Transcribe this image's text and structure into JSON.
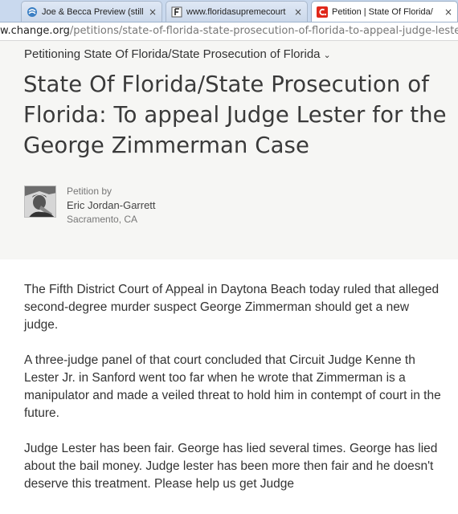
{
  "tabs": [
    {
      "title": "Joe & Becca Preview (still",
      "icon": "globe-icon",
      "active": false
    },
    {
      "title": "www.floridasupremecourt",
      "icon": "f-site-icon",
      "active": false
    },
    {
      "title": "Petition | State Of Florida/",
      "icon": "change-org-icon",
      "active": true
    }
  ],
  "tab_close_glyph": "×",
  "address": {
    "host": "w.change.org",
    "path": "/petitions/state-of-florida-state-prosecution-of-florida-to-appeal-judge-lester-f"
  },
  "petition": {
    "petitioning": "Petitioning State Of Florida/State Prosecution of Florida",
    "title": "State Of Florida/State Prosecution of Florida: To appeal Judge Lester for the George Zimmerman Case",
    "petition_by_label": "Petition by",
    "author_name": "Eric Jordan-Garrett",
    "author_location": "Sacramento, CA"
  },
  "body": {
    "paragraphs": [
      "The Fifth District Court of Appeal in Daytona Beach today ruled that alleged second-degree murder suspect George Zimmerman should get a new judge.",
      "A three-judge panel of that court concluded that Circuit Judge Kenne th Lester Jr. in Sanford went too far when he wrote that Zimmerman is a manipulator and made a veiled threat to hold him in contempt of court in the future.",
      "Judge Lester has been fair. George has lied several times. George has lied about the bail money. Judge lester has been more then fair and he doesn't deserve this treatment. Please help us get Judge"
    ]
  },
  "colors": {
    "change_red": "#e0281b",
    "header_bg": "#f6f6f4",
    "tab_strip": "#c9d9ee"
  }
}
